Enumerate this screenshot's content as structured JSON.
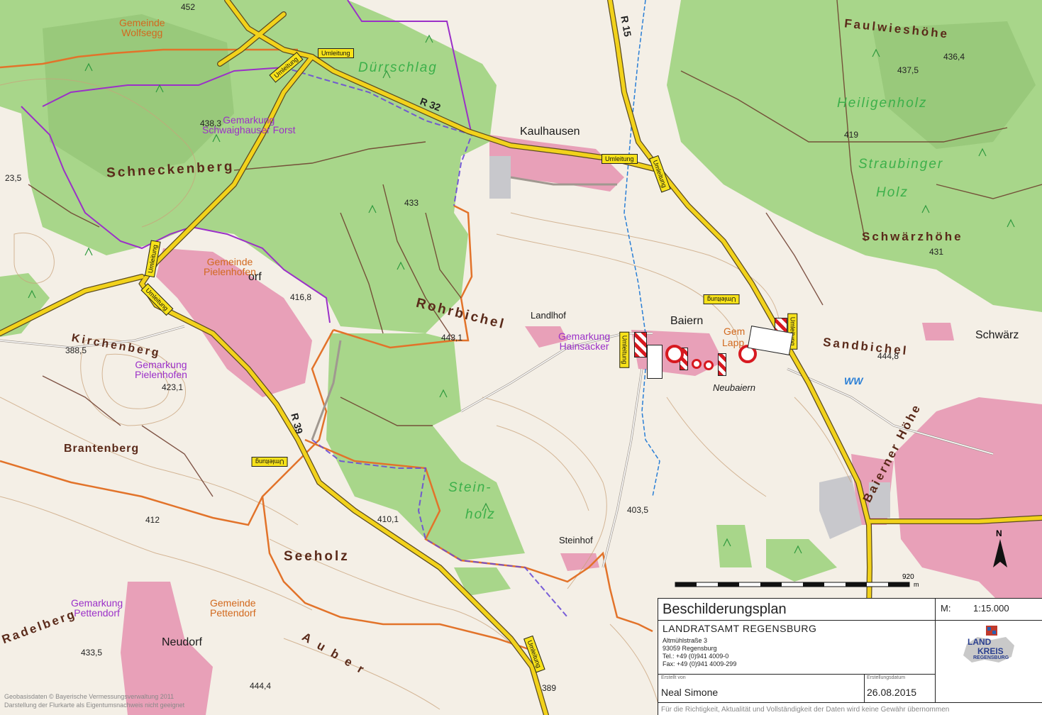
{
  "map": {
    "places": [
      "Kaulhausen",
      "Baiern",
      "Neubaiern",
      "Landlhof",
      "Steinhof",
      "Neudorf",
      "Schwärz"
    ],
    "place_partial": "orf",
    "place_gem_partial": "Gem",
    "place_lapp_partial": "Lapp",
    "forests": [
      "Dürrschlag",
      "Heiligenholz",
      "Straubinger",
      "Holz",
      "Stein-",
      "holz"
    ],
    "terrain": [
      "Schneckenberg",
      "Rohrbichel",
      "Kirchenberg",
      "Brantenberg",
      "Seeholz",
      "Faulwieshöhe",
      "Schwärzhöhe",
      "Sandbichel",
      "Baierner Höhe",
      "Radelberg",
      "Auber"
    ],
    "gemeinden": {
      "wolfsegg": [
        "Gemeinde",
        "Wolfsegg"
      ],
      "pielenhofen": [
        "Gemeinde",
        "Pielenhofen"
      ],
      "pettendorf": [
        "Gemeinde",
        "Pettendorf"
      ]
    },
    "gemarkungen": {
      "schwaighauser": [
        "Gemarkung",
        "Schwaighauser Forst"
      ],
      "hainsacker": [
        "Gemarkung",
        "Hainsacker"
      ],
      "pielenhofen": [
        "Gemarkung",
        "Pielenhofen"
      ],
      "pettendorf": [
        "Gemarkung",
        "Pettendorf"
      ]
    },
    "elevations": [
      "452",
      "438.3",
      "433",
      "416,8",
      "388,5",
      "443,1",
      "423,1",
      "437,5",
      "436,4",
      "419",
      "431",
      "444,8",
      "412",
      "410,1",
      "403,5",
      "433,5",
      "444,4",
      "389",
      "23,5"
    ],
    "roads": [
      "R 15",
      "R 32",
      "R 39"
    ],
    "detour_label": "Umleitung",
    "ww_label": "WW",
    "north": "N",
    "scale_end": "920",
    "scale_unit": "m"
  },
  "legend": {
    "title": "Beschilderungsplan",
    "scale_key": "M:",
    "scale_value": "1:15.000",
    "org": "LANDRATSAMT REGENSBURG",
    "street": "Altmühlstraße 3",
    "city": "93059 Regensburg",
    "tel": "Tel.: +49 (0)941 4009-0",
    "fax": "Fax: +49 (0)941 4009-299",
    "created_by_caption": "Erstellt von",
    "created_by": "Neal Simone",
    "date_caption": "Erstellungsdatum",
    "date": "26.08.2015",
    "disclaimer": "Für die Richtigkeit, Aktualität und Vollständigkeit der Daten wird keine Gewähr übernommen",
    "logo": [
      "LAND",
      "KREIS",
      "REGENSBURG"
    ]
  },
  "copyright": [
    "Geobasisdaten © Bayerische Vermessungsverwaltung 2011",
    "Darstellung der Flurkarte als Eigentumsnachweis nicht geeignet"
  ],
  "colors": {
    "forest": "#a8d68a",
    "open": "#f4efe6",
    "settlement": "#e8a0b8",
    "road": "#f2d21b",
    "contour": "#c9a27a",
    "boundary_gem": "#e2732a",
    "boundary_gmk": "#9b30c8",
    "water": "#2a7fd6"
  }
}
